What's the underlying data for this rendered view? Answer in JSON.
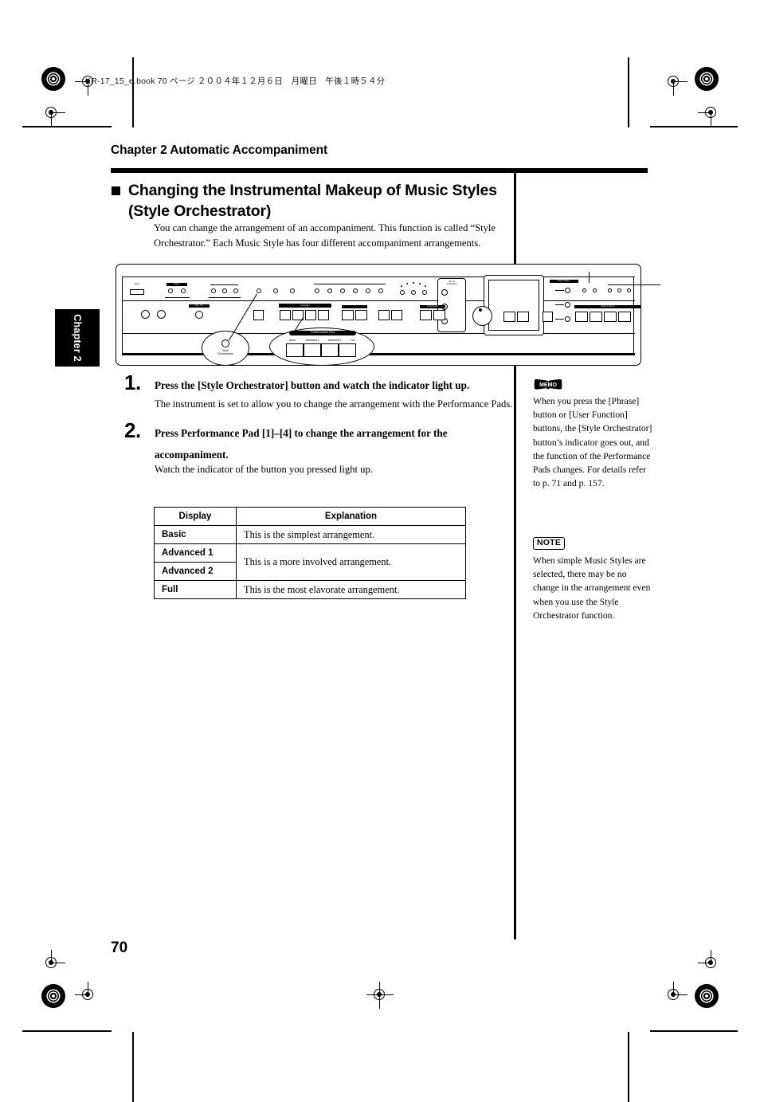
{
  "print_slug": "KR-17_15_e.book  70 ページ  ２００４年１２月６日　月曜日　午後１時５４分",
  "chapter_tab": "Chapter 2",
  "chapter_title": "Chapter 2 Automatic Accompaniment",
  "section": {
    "title": "Changing the Instrumental Makeup of Music Styles (Style Orchestrator)",
    "intro": "You can change the arrangement of an accompaniment. This function is called “Style Orchestrator.” Each Music Style has four different accompaniment arrangements."
  },
  "figure": {
    "callout_style_orchestrator": "Style\nOrchestrator",
    "callout_performance_pad_header": "Performance Pad",
    "pad_labels": [
      "Basic",
      "Advanced 1",
      "Advanced 2",
      "Full"
    ],
    "panel_groups": [
      "Piano",
      "Organ",
      "Others",
      "Music Style",
      "One Touch Program",
      "Song Collection",
      "Accomp",
      "Arranger",
      "Composer"
    ]
  },
  "steps": [
    {
      "number": "1.",
      "heading": "Press the [Style Orchestrator] button and watch the indicator light up.",
      "body": "The instrument is set to allow you to change the arrangement with the Performance Pads."
    },
    {
      "number": "2.",
      "heading": "Press Performance Pad [1]–[4] to change the arrangement for the accompaniment.",
      "body": "Watch the indicator of the button you pressed light up."
    }
  ],
  "table": {
    "headers": [
      "Display",
      "Explanation"
    ],
    "rows": [
      {
        "display": "Basic",
        "explanation": "This is the simplest arrangement."
      },
      {
        "display": "Advanced 1",
        "explanation": "This is a more involved arrangement."
      },
      {
        "display": "Advanced 2",
        "explanation": ""
      },
      {
        "display": "Full",
        "explanation": "This is the most elavorate arrangement."
      }
    ]
  },
  "side_notes": {
    "memo_label": "MEMO",
    "memo_text": "When you press the [Phrase] button or [User Function] buttons, the [Style Orchestrator] button’s indicator goes out, and the function of the Performance Pads changes. For details refer to p. 71 and p. 157.",
    "note_label": "NOTE",
    "note_text": "When simple Music Styles are selected, there may be no change in the arrangement even when you use the Style Orchestrator function."
  },
  "page_number": "70"
}
